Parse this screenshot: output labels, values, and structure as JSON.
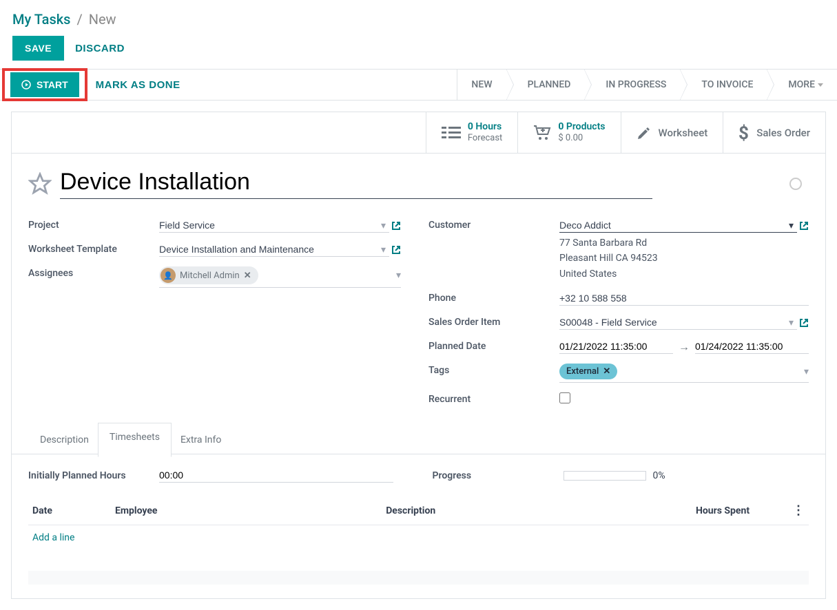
{
  "breadcrumb": {
    "parent": "My Tasks",
    "current": "New"
  },
  "actions": {
    "save": "SAVE",
    "discard": "DISCARD",
    "start": "START",
    "mark_done": "MARK AS DONE"
  },
  "stages": [
    "NEW",
    "PLANNED",
    "IN PROGRESS",
    "TO INVOICE",
    "MORE"
  ],
  "stat_buttons": {
    "hours": {
      "num": "0",
      "label": "Hours",
      "sub": "Forecast"
    },
    "products": {
      "num": "0",
      "label": "Products",
      "sub": "$ 0.00"
    },
    "worksheet": "Worksheet",
    "sales_order": "Sales Order"
  },
  "title": "Device Installation",
  "form": {
    "left": {
      "project_label": "Project",
      "project_value": "Field Service",
      "template_label": "Worksheet Template",
      "template_value": "Device Installation and Maintenance",
      "assignees_label": "Assignees",
      "assignee_name": "Mitchell Admin"
    },
    "right": {
      "customer_label": "Customer",
      "customer_value": "Deco Addict",
      "address_line1": "77 Santa Barbara Rd",
      "address_line2": "Pleasant Hill CA 94523",
      "address_line3": "United States",
      "phone_label": "Phone",
      "phone_value": "+32 10 588 558",
      "soi_label": "Sales Order Item",
      "soi_value": "S00048 - Field Service",
      "planned_label": "Planned Date",
      "planned_start": "01/21/2022 11:35:00",
      "planned_end": "01/24/2022 11:35:00",
      "tags_label": "Tags",
      "tag_value": "External",
      "recurrent_label": "Recurrent"
    }
  },
  "tabs": {
    "description": "Description",
    "timesheets": "Timesheets",
    "extra": "Extra Info"
  },
  "timesheet": {
    "planned_label": "Initially Planned Hours",
    "planned_value": "00:00",
    "progress_label": "Progress",
    "progress_value": "0%",
    "columns": {
      "date": "Date",
      "employee": "Employee",
      "desc": "Description",
      "hours": "Hours Spent"
    },
    "add_line": "Add a line"
  }
}
